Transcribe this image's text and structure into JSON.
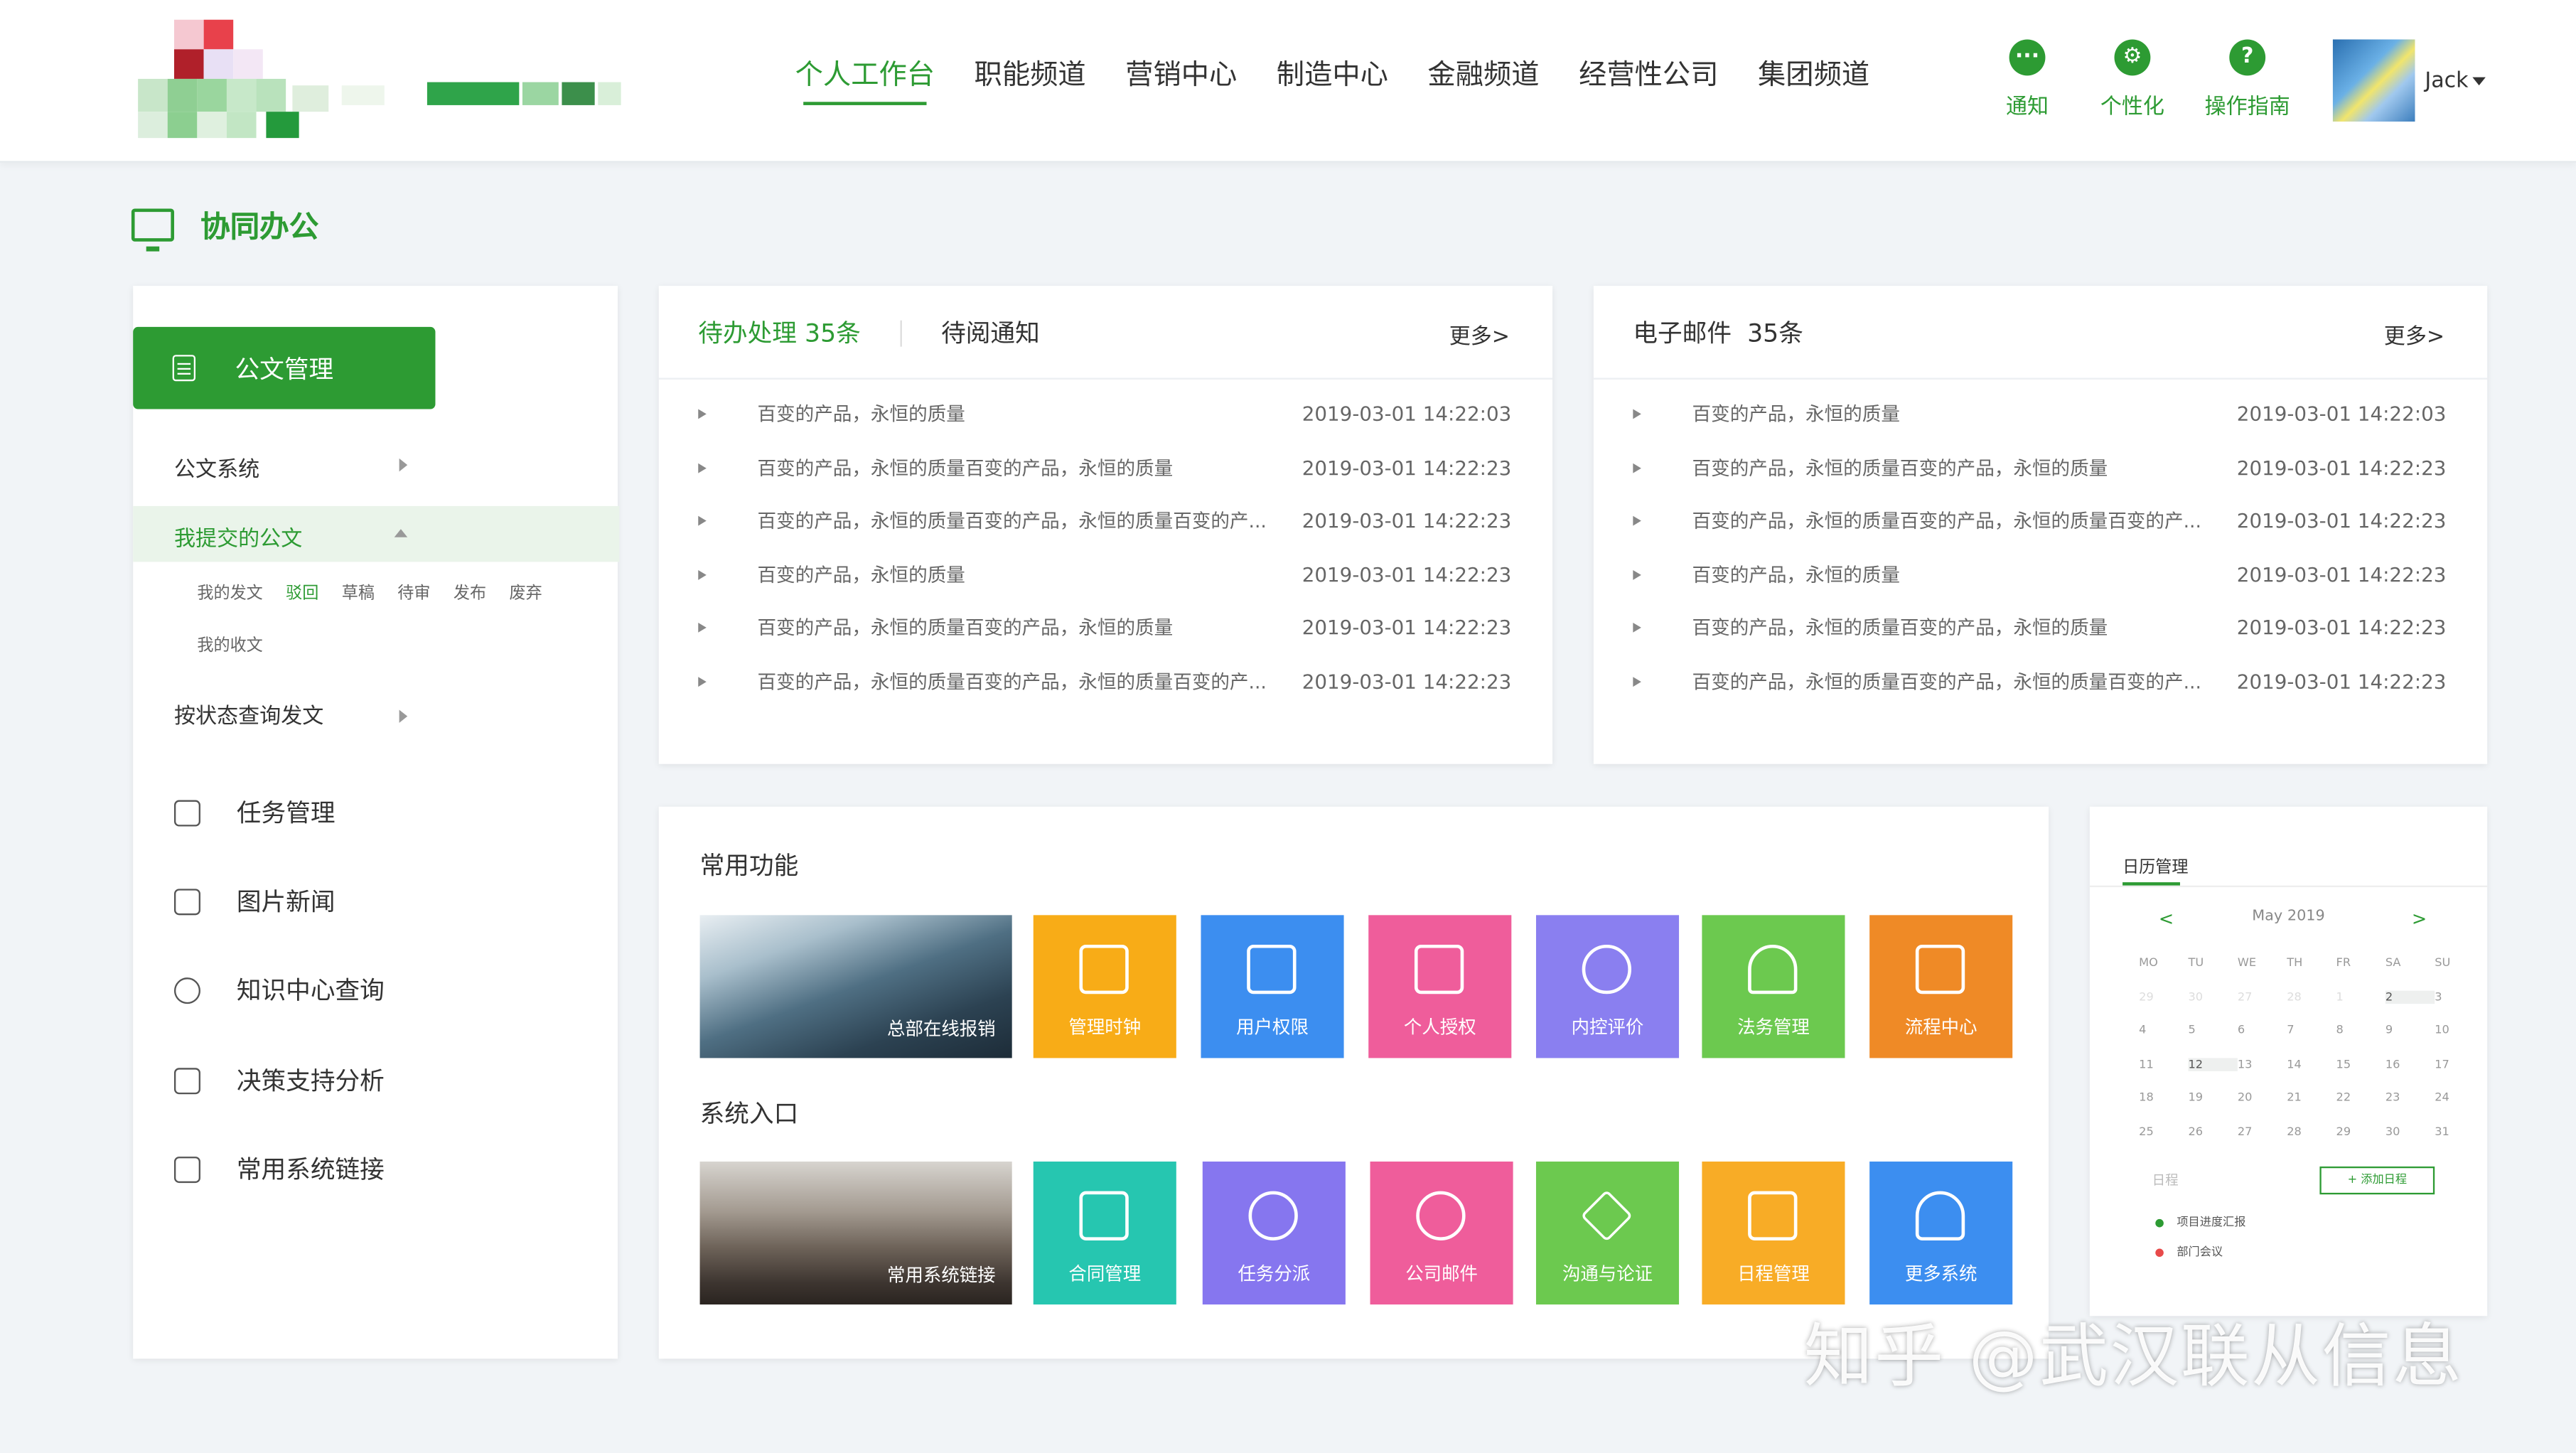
{
  "header": {
    "nav": [
      {
        "label": "个人工作台",
        "active": true
      },
      {
        "label": "职能频道"
      },
      {
        "label": "营销中心"
      },
      {
        "label": "制造中心"
      },
      {
        "label": "金融频道"
      },
      {
        "label": "经营性公司"
      },
      {
        "label": "集团频道"
      }
    ],
    "tools": [
      {
        "label": "通知",
        "icon": "chat-bubble-icon",
        "glyph": "···"
      },
      {
        "label": "个性化",
        "icon": "gear-icon",
        "glyph": "⚙"
      },
      {
        "label": "操作指南",
        "icon": "question-icon",
        "glyph": "?"
      }
    ],
    "user": "Jack"
  },
  "page_title": "协同办公",
  "sidebar": {
    "head": "公文管理",
    "items": {
      "system": "公文系统",
      "submitted": "我提交的公文",
      "sub_tabs": [
        "我的发文",
        "驳回",
        "草稿",
        "待审",
        "发布",
        "废弃"
      ],
      "received": "我的收文",
      "query": "按状态查询发文"
    },
    "menu": [
      {
        "label": "任务管理",
        "icon": "play-icon"
      },
      {
        "label": "图片新闻",
        "icon": "share-icon"
      },
      {
        "label": "知识中心查询",
        "icon": "clock-icon"
      },
      {
        "label": "决策支持分析",
        "icon": "document-icon"
      },
      {
        "label": "常用系统链接",
        "icon": "lock-icon"
      }
    ]
  },
  "todo_panel": {
    "tab_active": "待办处理",
    "tab_active_count": "35条",
    "tab_other": "待阅通知",
    "more": "更多>",
    "rows": [
      {
        "text": "百变的产品，永恒的质量",
        "date": "2019-03-01 14:22:03"
      },
      {
        "text": "百变的产品，永恒的质量百变的产品，永恒的质量",
        "date": "2019-03-01 14:22:23"
      },
      {
        "text": "百变的产品，永恒的质量百变的产品，永恒的质量百变的产...",
        "date": "2019-03-01 14:22:23"
      },
      {
        "text": "百变的产品，永恒的质量",
        "date": "2019-03-01 14:22:23"
      },
      {
        "text": "百变的产品，永恒的质量百变的产品，永恒的质量",
        "date": "2019-03-01 14:22:23"
      },
      {
        "text": "百变的产品，永恒的质量百变的产品，永恒的质量百变的产...",
        "date": "2019-03-01 14:22:23"
      }
    ]
  },
  "mail_panel": {
    "title": "电子邮件",
    "count": "35条",
    "more": "更多>",
    "rows": [
      {
        "text": "百变的产品，永恒的质量",
        "date": "2019-03-01 14:22:03"
      },
      {
        "text": "百变的产品，永恒的质量百变的产品，永恒的质量",
        "date": "2019-03-01 14:22:23"
      },
      {
        "text": "百变的产品，永恒的质量百变的产品，永恒的质量百变的产...",
        "date": "2019-03-01 14:22:23"
      },
      {
        "text": "百变的产品，永恒的质量",
        "date": "2019-03-01 14:22:23"
      },
      {
        "text": "百变的产品，永恒的质量百变的产品，永恒的质量",
        "date": "2019-03-01 14:22:23"
      },
      {
        "text": "百变的产品，永恒的质量百变的产品，永恒的质量百变的产...",
        "date": "2019-03-01 14:22:23"
      }
    ]
  },
  "functions": {
    "common_title": "常用功能",
    "common_photo": "总部在线报销",
    "common": [
      {
        "label": "管理时钟",
        "color": "#f8ac17",
        "icon": "book-icon"
      },
      {
        "label": "用户权限",
        "color": "#3c8ef0",
        "icon": "building-icon"
      },
      {
        "label": "个人授权",
        "color": "#ef5d9b",
        "icon": "contact-icon"
      },
      {
        "label": "内控评价",
        "color": "#8a7ff0",
        "icon": "search-money-icon"
      },
      {
        "label": "法务管理",
        "color": "#6cc94f",
        "icon": "bell-icon"
      },
      {
        "label": "流程中心",
        "color": "#ef8a26",
        "icon": "tray-icon"
      }
    ],
    "system_title": "系统入口",
    "system_photo": "常用系统链接",
    "system": [
      {
        "label": "合同管理",
        "color": "#26c6b0",
        "icon": "contract-icon"
      },
      {
        "label": "任务分派",
        "color": "#8676ef",
        "icon": "target-icon"
      },
      {
        "label": "公司邮件",
        "color": "#ef5d9b",
        "icon": "hammer-sickle-icon"
      },
      {
        "label": "沟通与论证",
        "color": "#6cc94f",
        "icon": "plane-icon"
      },
      {
        "label": "日程管理",
        "color": "#f8ac26",
        "icon": "clipboard-icon"
      },
      {
        "label": "更多系统",
        "color": "#3c8ef0",
        "icon": "weather-icon"
      }
    ]
  },
  "calendar": {
    "title": "日历管理",
    "prev": "<",
    "next": ">",
    "month": "May  2019",
    "weekdays": [
      "MO",
      "TU",
      "WE",
      "TH",
      "FR",
      "SA",
      "SU"
    ],
    "weeks": [
      [
        "29",
        "30",
        "27",
        "28",
        "1",
        "2",
        "3"
      ],
      [
        "4",
        "5",
        "6",
        "7",
        "8",
        "9",
        "10"
      ],
      [
        "11",
        "12",
        "13",
        "14",
        "15",
        "16",
        "17"
      ],
      [
        "18",
        "19",
        "20",
        "21",
        "22",
        "23",
        "24"
      ],
      [
        "25",
        "26",
        "27",
        "28",
        "29",
        "30",
        "31"
      ]
    ],
    "schedule_label": "日程",
    "add_label": "+ 添加日程",
    "events": [
      {
        "label": "项目进度汇报",
        "color": "#2d9b33"
      },
      {
        "label": "部门会议",
        "color": "#e84a4a"
      }
    ]
  },
  "watermark": "知乎 @武汉联从信息"
}
